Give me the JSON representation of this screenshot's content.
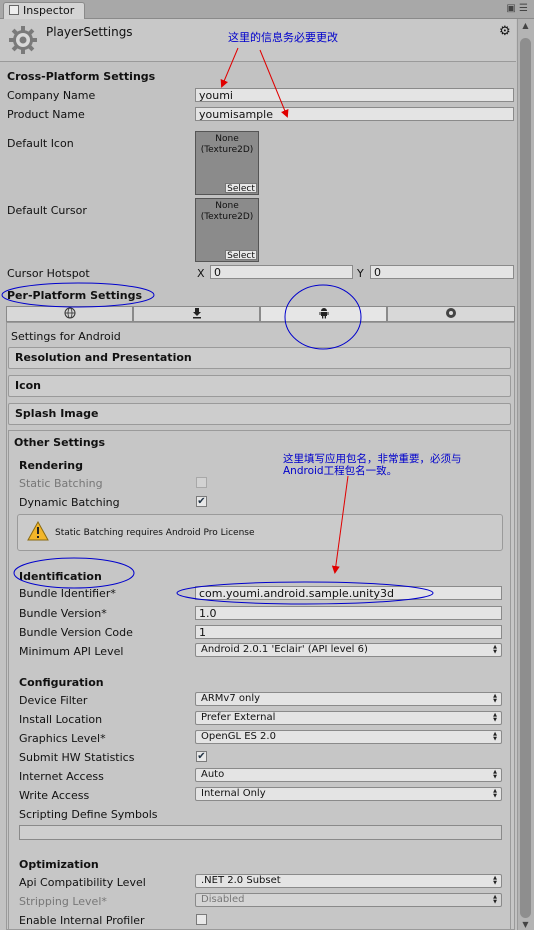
{
  "window": {
    "tab_title": "Inspector",
    "title": "PlayerSettings"
  },
  "cross_platform": {
    "heading": "Cross-Platform Settings",
    "company_name_label": "Company Name",
    "company_name_value": "youmi",
    "product_name_label": "Product Name",
    "product_name_value": "youmisample",
    "default_icon_label": "Default Icon",
    "default_cursor_label": "Default Cursor",
    "texture_none": "None",
    "texture_type": "(Texture2D)",
    "select_label": "Select",
    "cursor_hotspot_label": "Cursor Hotspot",
    "hotspot_x_label": "X",
    "hotspot_x_value": "0",
    "hotspot_y_label": "Y",
    "hotspot_y_value": "0"
  },
  "per_platform": {
    "heading": "Per-Platform Settings",
    "tabs": [
      "web-globe-icon",
      "standalone-download-icon",
      "android-icon",
      "flash-icon"
    ],
    "settings_for": "Settings for Android",
    "sections": {
      "resolution": "Resolution and Presentation",
      "icon": "Icon",
      "splash": "Splash Image",
      "other": "Other Settings"
    }
  },
  "rendering": {
    "heading": "Rendering",
    "static_batching_label": "Static Batching",
    "dynamic_batching_label": "Dynamic Batching",
    "dynamic_batching_checked": "✔",
    "warning_text": "Static Batching requires Android Pro License"
  },
  "identification": {
    "heading": "Identification",
    "bundle_identifier_label": "Bundle Identifier*",
    "bundle_identifier_value": "com.youmi.android.sample.unity3d",
    "bundle_version_label": "Bundle Version*",
    "bundle_version_value": "1.0",
    "bundle_version_code_label": "Bundle Version Code",
    "bundle_version_code_value": "1",
    "min_api_label": "Minimum API Level",
    "min_api_value": "Android 2.0.1 'Eclair' (API level 6)"
  },
  "configuration": {
    "heading": "Configuration",
    "device_filter_label": "Device Filter",
    "device_filter_value": "ARMv7 only",
    "install_location_label": "Install Location",
    "install_location_value": "Prefer External",
    "graphics_level_label": "Graphics Level*",
    "graphics_level_value": "OpenGL ES 2.0",
    "submit_hw_label": "Submit HW Statistics",
    "submit_hw_checked": "✔",
    "internet_access_label": "Internet Access",
    "internet_access_value": "Auto",
    "write_access_label": "Write Access",
    "write_access_value": "Internal Only",
    "scripting_symbols_label": "Scripting Define Symbols",
    "scripting_symbols_value": ""
  },
  "optimization": {
    "heading": "Optimization",
    "api_compat_label": "Api Compatibility Level",
    "api_compat_value": ".NET 2.0 Subset",
    "stripping_label": "Stripping Level*",
    "stripping_value": "Disabled",
    "profiler_label": "Enable Internal Profiler"
  },
  "annotations": {
    "note_top": "这里的信息务必要更改",
    "note_bundle_line1": "这里填写应用包名，非常重要，必须与",
    "note_bundle_line2": "Android工程包名一致。",
    "color": "#0000cc"
  }
}
